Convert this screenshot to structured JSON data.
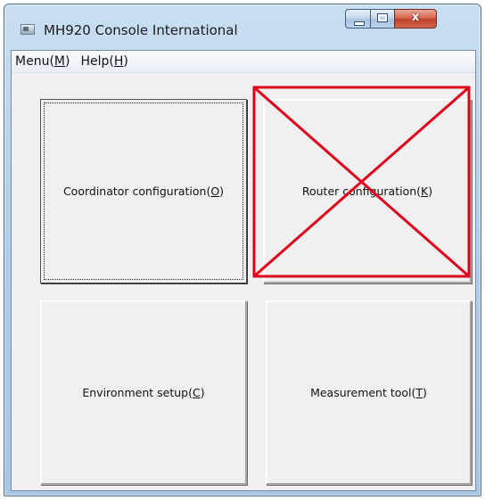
{
  "window": {
    "title": "MH920 Console International",
    "close_glyph": "x"
  },
  "menu": {
    "items": [
      {
        "label": "Menu(",
        "mnemonic": "M",
        "suffix": ")"
      },
      {
        "label": "Help(",
        "mnemonic": "H",
        "suffix": ")"
      }
    ]
  },
  "buttons": {
    "coordinator": {
      "label": "Coordinator configuration(",
      "mnemonic": "O",
      "suffix": ")"
    },
    "router": {
      "label": "Router configuration(",
      "mnemonic": "K",
      "suffix": ")",
      "crossed_out": true
    },
    "environment": {
      "label": "Environment setup(",
      "mnemonic": "C",
      "suffix": ")"
    },
    "measurement": {
      "label": "Measurement tool(",
      "mnemonic": "T",
      "suffix": ")"
    }
  },
  "colors": {
    "cross_out": "#e0001b"
  },
  "icons": {
    "app": "app-window-icon",
    "minimize": "minimize-icon",
    "maximize": "maximize-icon",
    "close": "close-icon"
  }
}
